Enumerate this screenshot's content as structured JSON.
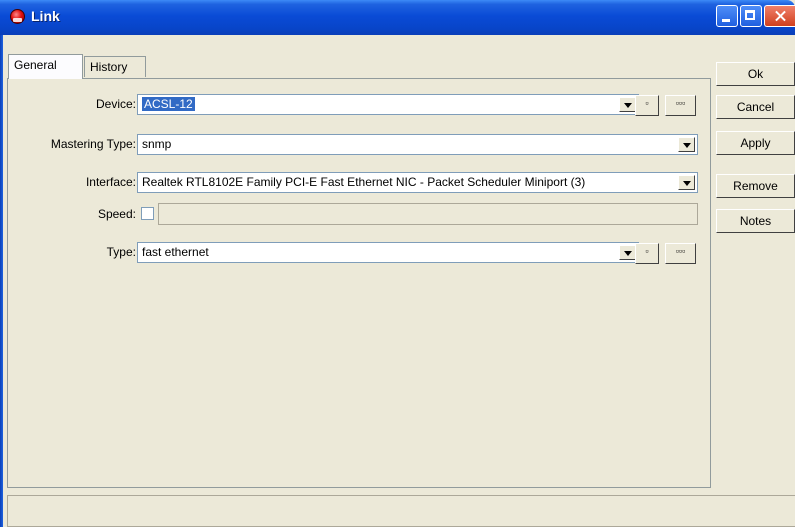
{
  "window": {
    "title": "Link"
  },
  "tabs": [
    {
      "label": "General",
      "active": true
    },
    {
      "label": "History",
      "active": false
    }
  ],
  "form": {
    "device": {
      "label": "Device:",
      "value": "ACSL-12"
    },
    "mastering_type": {
      "label": "Mastering Type:",
      "value": "snmp"
    },
    "interface": {
      "label": "Interface:",
      "value": "Realtek RTL8102E Family PCI-E Fast Ethernet NIC - Packet Scheduler Miniport  (3)"
    },
    "speed": {
      "label": "Speed:",
      "checked": false,
      "value": ""
    },
    "type": {
      "label": "Type:",
      "value": "fast ethernet"
    }
  },
  "small_buttons": {
    "one": "▫",
    "more": "▫▫▫"
  },
  "side_buttons": {
    "ok": "Ok",
    "cancel": "Cancel",
    "apply": "Apply",
    "remove": "Remove",
    "notes": "Notes"
  },
  "colors": {
    "titlebar": "#0a4bd6",
    "selection": "#316ac5",
    "face": "#ece9d8"
  }
}
